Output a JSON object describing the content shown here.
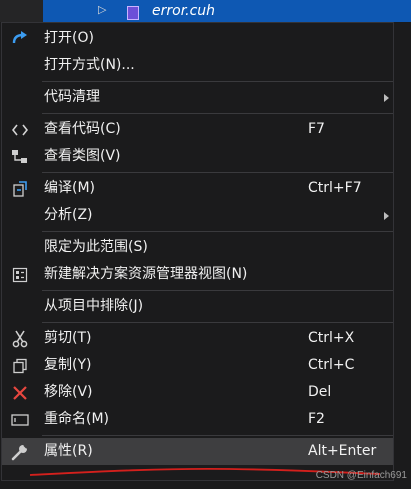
{
  "tree": {
    "file_name": "error.cuh"
  },
  "menu": {
    "open": {
      "label": "打开(O)"
    },
    "open_with": {
      "label": "打开方式(N)..."
    },
    "code_cleanup": {
      "label": "代码清理"
    },
    "view_code": {
      "label": "查看代码(C)",
      "shortcut": "F7"
    },
    "view_class_diagram": {
      "label": "查看类图(V)"
    },
    "compile": {
      "label": "编译(M)",
      "shortcut": "Ctrl+F7"
    },
    "analyze": {
      "label": "分析(Z)"
    },
    "scope_to_this": {
      "label": "限定为此范围(S)"
    },
    "new_solution_explorer_view": {
      "label": "新建解决方案资源管理器视图(N)"
    },
    "exclude_from_project": {
      "label": "从项目中排除(J)"
    },
    "cut": {
      "label": "剪切(T)",
      "shortcut": "Ctrl+X"
    },
    "copy": {
      "label": "复制(Y)",
      "shortcut": "Ctrl+C"
    },
    "remove": {
      "label": "移除(V)",
      "shortcut": "Del"
    },
    "rename": {
      "label": "重命名(M)",
      "shortcut": "F2"
    },
    "properties": {
      "label": "属性(R)",
      "shortcut": "Alt+Enter"
    }
  },
  "watermark": "CSDN @Einfach691",
  "colors": {
    "accent_blue": "#0e58b3",
    "highlight": "#3e3e40",
    "remove_red": "#e8473f",
    "annotation_red": "#d4201c"
  }
}
